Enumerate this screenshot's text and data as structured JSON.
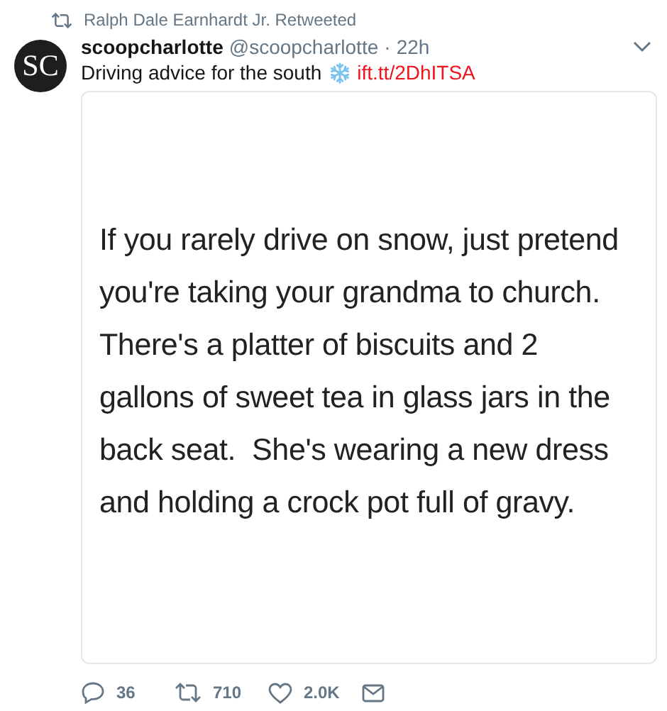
{
  "retweet_context": {
    "text": "Ralph Dale Earnhardt Jr. Retweeted"
  },
  "tweet": {
    "avatar_text": "SC",
    "display_name": "scoopcharlotte",
    "handle": "@scoopcharlotte",
    "separator": "·",
    "time": "22h",
    "text": "Driving advice for the south",
    "link": "ift.tt/2DhITSA",
    "image_text_lines": [
      "If you rarely drive on snow, just pretend",
      "you're taking your grandma to church.",
      "There's a platter of biscuits and 2",
      "gallons of sweet tea in glass jars in the",
      "back seat.  She's wearing a new dress",
      "and holding a crock pot full of gravy."
    ]
  },
  "actions": [
    {
      "kind": "reply",
      "count": "36"
    },
    {
      "kind": "retweet",
      "count": "710"
    },
    {
      "kind": "like",
      "count": "2.0K"
    },
    {
      "kind": "message"
    }
  ]
}
